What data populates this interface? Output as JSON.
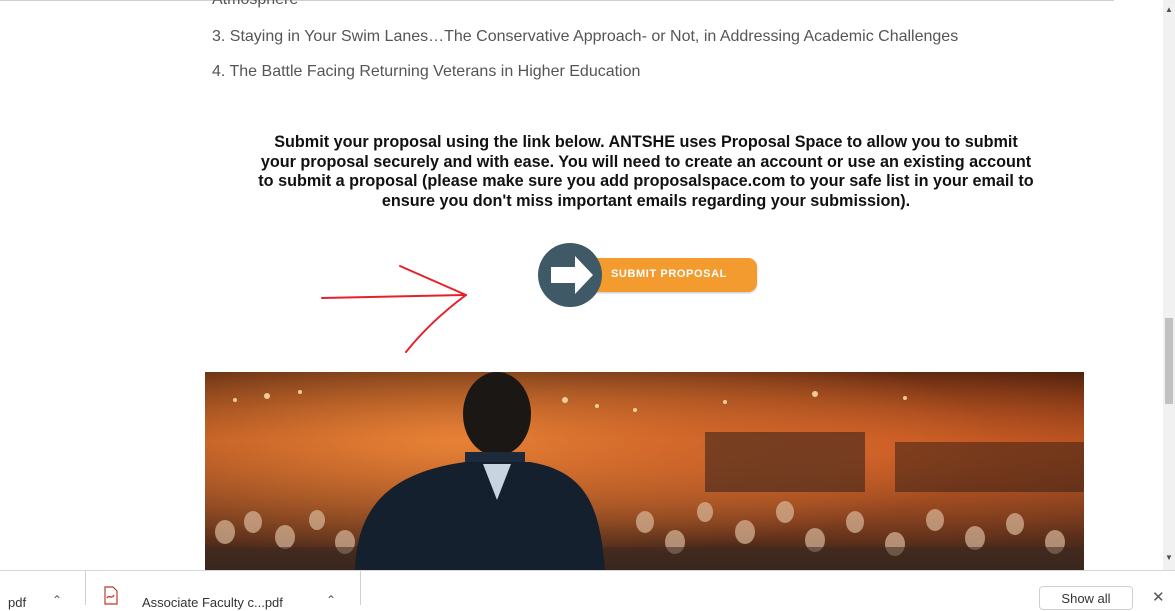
{
  "page": {
    "cut_line": "Atmosphere",
    "list_items": [
      "3. Staying in Your Swim Lanes…The Conservative Approach- or Not, in Addressing Academic Challenges",
      "4. The Battle Facing Returning Veterans in Higher Education"
    ],
    "notice_lines": [
      "Submit your proposal using the link below. ANTSHE uses Proposal Space to allow you to submit",
      "your proposal securely and with ease. You will need to create an account or use an existing account",
      "to submit a proposal (please make sure you add proposalspace.com to your safe list in your email to",
      "ensure you don't miss important emails regarding your submission)."
    ],
    "submit_button_label": "SUBMIT PROPOSAL"
  },
  "downloads": {
    "items": [
      {
        "name": "pdf",
        "icon": "chevron-up-icon"
      },
      {
        "name": "Associate Faculty c...pdf",
        "icon": "pdf-file-icon"
      }
    ],
    "show_all_label": "Show all",
    "close_label": "✕"
  },
  "colors": {
    "accent_orange": "#f39b2e",
    "button_circle": "#3f5966",
    "annotation_red": "#e8202a",
    "text_gray": "#555555"
  }
}
